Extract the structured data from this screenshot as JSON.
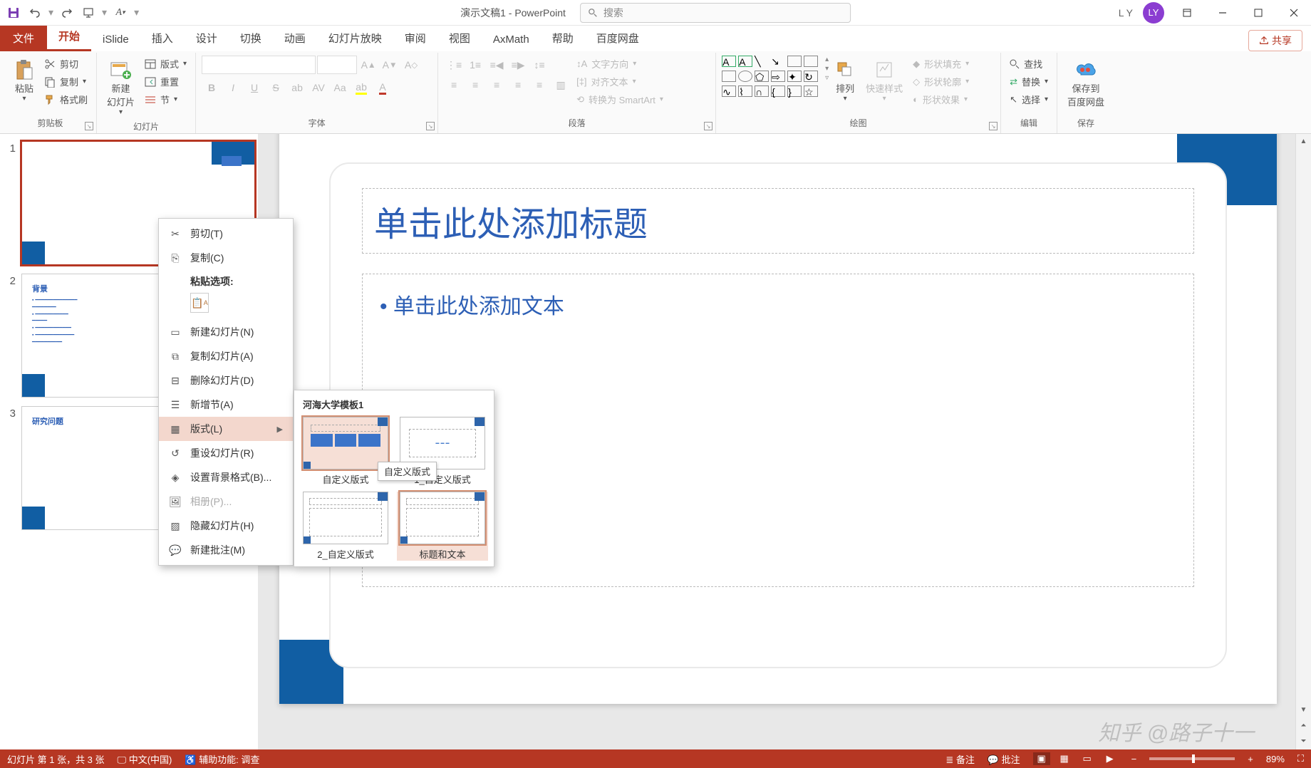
{
  "title": "演示文稿1 - PowerPoint",
  "search_placeholder": "搜索",
  "user_initials_text": "L Y",
  "user_initials_avatar": "LY",
  "tabs": {
    "file": "文件",
    "home": "开始",
    "islide": "iSlide",
    "insert": "插入",
    "design": "设计",
    "transition": "切换",
    "animation": "动画",
    "slideshow": "幻灯片放映",
    "review": "审阅",
    "view": "视图",
    "axmath": "AxMath",
    "help": "帮助",
    "baidu": "百度网盘"
  },
  "share": "共享",
  "groups": {
    "clipboard": {
      "label": "剪贴板",
      "paste": "粘贴",
      "cut": "剪切",
      "copy": "复制",
      "format_painter": "格式刷"
    },
    "slides": {
      "label": "幻灯片",
      "new_slide": "新建\n幻灯片",
      "layout": "版式",
      "reset": "重置",
      "section": "节"
    },
    "font": {
      "label": "字体"
    },
    "paragraph": {
      "label": "段落",
      "text_direction": "文字方向",
      "align_text": "对齐文本",
      "smartart": "转换为 SmartArt"
    },
    "drawing": {
      "label": "绘图",
      "arrange": "排列",
      "quick_styles": "快速样式",
      "fill": "形状填充",
      "outline": "形状轮廓",
      "effects": "形状效果"
    },
    "editing": {
      "label": "编辑",
      "find": "查找",
      "replace": "替换",
      "select": "选择"
    },
    "save": {
      "label": "保存",
      "save_to": "保存到\n百度网盘"
    }
  },
  "thumbs": {
    "s1": {
      "num": "1"
    },
    "s2": {
      "num": "2",
      "title": "背景"
    },
    "s3": {
      "num": "3",
      "title": "研究问题"
    }
  },
  "slide": {
    "logo": "logo",
    "title_ph": "单击此处添加标题",
    "body_ph": "单击此处添加文本"
  },
  "context_menu": {
    "cut": "剪切(T)",
    "copy": "复制(C)",
    "paste_label": "粘贴选项:",
    "new_slide": "新建幻灯片(N)",
    "duplicate": "复制幻灯片(A)",
    "delete": "删除幻灯片(D)",
    "add_section": "新增节(A)",
    "layout": "版式(L)",
    "reset": "重设幻灯片(R)",
    "bg": "设置背景格式(B)...",
    "album": "相册(P)...",
    "hide": "隐藏幻灯片(H)",
    "comment": "新建批注(M)"
  },
  "flyout": {
    "title": "河海大学模板1",
    "l1": "自定义版式",
    "l2": "1_自定义版式",
    "l3": "2_自定义版式",
    "l4": "标题和文本",
    "tooltip": "自定义版式"
  },
  "status": {
    "slide_info": "幻灯片 第 1 张，共 3 张",
    "lang": "中文(中国)",
    "accessibility": "辅助功能: 调查",
    "notes": "备注",
    "comments": "批注",
    "zoom": "89%"
  },
  "watermark": "知乎 @路子十一"
}
